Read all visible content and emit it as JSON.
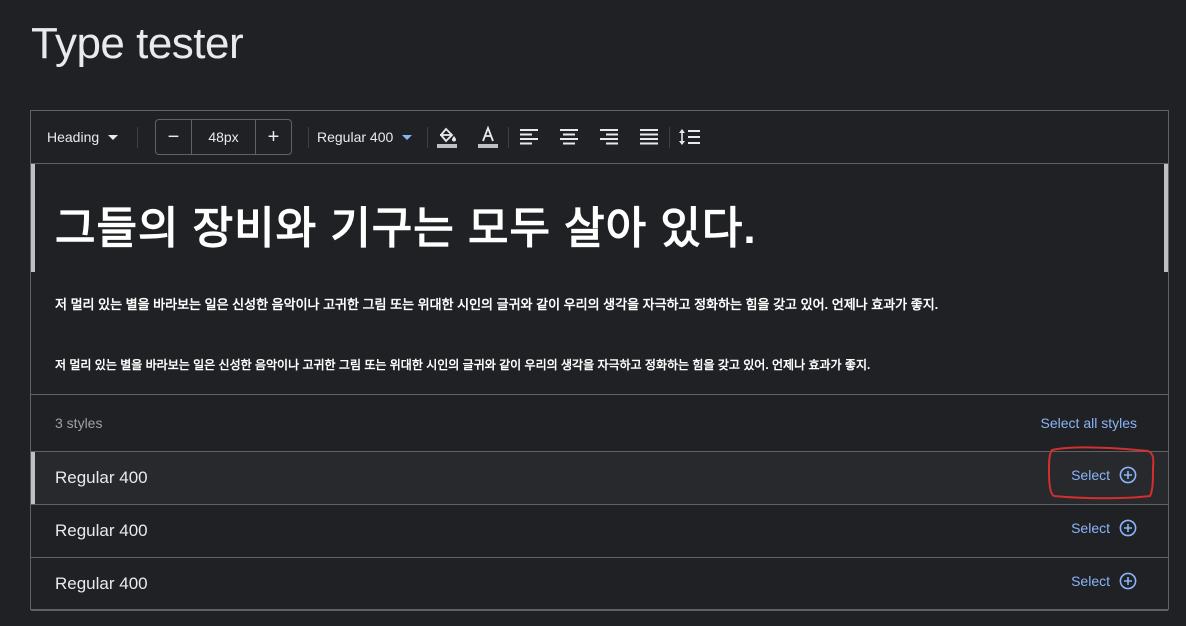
{
  "page": {
    "title": "Type tester"
  },
  "toolbar": {
    "style_dropdown": "Heading",
    "size_minus": "−",
    "size_value": "48px",
    "size_plus": "+",
    "weight_dropdown": "Regular 400",
    "icons": [
      "fill-color-icon",
      "text-color-icon",
      "align-left-icon",
      "align-center-icon",
      "align-right-icon",
      "align-justify-icon",
      "line-height-icon"
    ]
  },
  "preview": {
    "heading": "그들의 장비와 기구는 모두 살아 있다.",
    "body_1": "저 멀리 있는 별을 바라보는 일은 신성한 음악이나 고귀한 그림 또는 위대한 시인의 글귀와 같이 우리의 생각을 자극하고 정화하는 힘을 갖고 있어. 언제나 효과가 좋지.",
    "body_2": "저 멀리 있는 별을 바라보는 일은 신성한 음악이나 고귀한 그림 또는 위대한 시인의 글귀와 같이 우리의 생각을 자극하고 정화하는 힘을 갖고 있어. 언제나 효과가 좋지."
  },
  "styles": {
    "count_label": "3 styles",
    "select_all_label": "Select all styles",
    "rows": [
      {
        "name": "Regular 400",
        "select_label": "Select"
      },
      {
        "name": "Regular 400",
        "select_label": "Select"
      },
      {
        "name": "Regular 400",
        "select_label": "Select"
      }
    ]
  },
  "colors": {
    "background": "#202124",
    "accent": "#8ab4f8",
    "border": "#5f6368",
    "annotation": "#d32f2f"
  }
}
